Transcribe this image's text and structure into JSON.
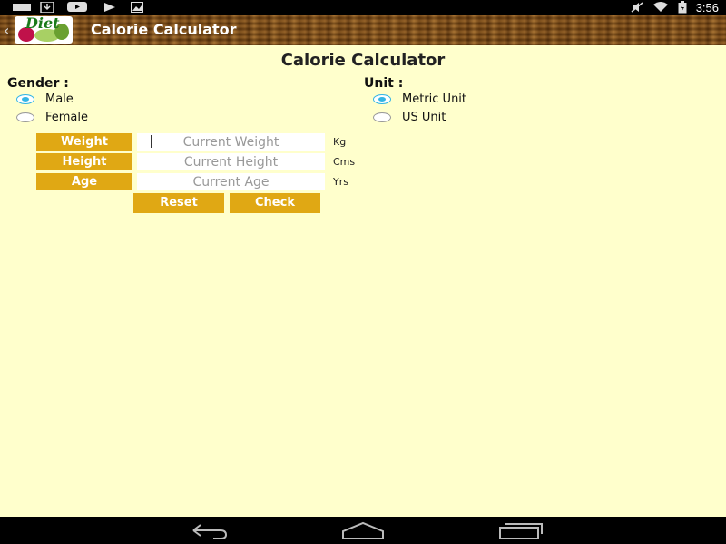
{
  "status_bar": {
    "time": "3:56",
    "left_icons": [
      "notification-icon",
      "download-icon",
      "youtube-icon",
      "play-store-icon",
      "gallery-icon"
    ],
    "right_icons": [
      "mute-icon",
      "wifi-icon",
      "battery-icon"
    ]
  },
  "action_bar": {
    "title": "Calorie Calculator",
    "logo_text": "Diet"
  },
  "page": {
    "title": "Calorie Calculator"
  },
  "gender": {
    "label": "Gender :",
    "options": [
      {
        "label": "Male",
        "checked": true
      },
      {
        "label": "Female",
        "checked": false
      }
    ]
  },
  "unit": {
    "label": "Unit :",
    "options": [
      {
        "label": "Metric Unit",
        "checked": true
      },
      {
        "label": "US Unit",
        "checked": false
      }
    ]
  },
  "fields": {
    "weight": {
      "label": "Weight",
      "placeholder": "Current Weight",
      "unit": "Kg"
    },
    "height": {
      "label": "Height",
      "placeholder": "Current Height",
      "unit": "Cms"
    },
    "age": {
      "label": "Age",
      "placeholder": "Current Age",
      "unit": "Yrs"
    }
  },
  "buttons": {
    "reset": "Reset",
    "check": "Check"
  },
  "colors": {
    "background": "#ffffcc",
    "accent": "#e0a814",
    "radio_checked": "#33b5e5"
  }
}
